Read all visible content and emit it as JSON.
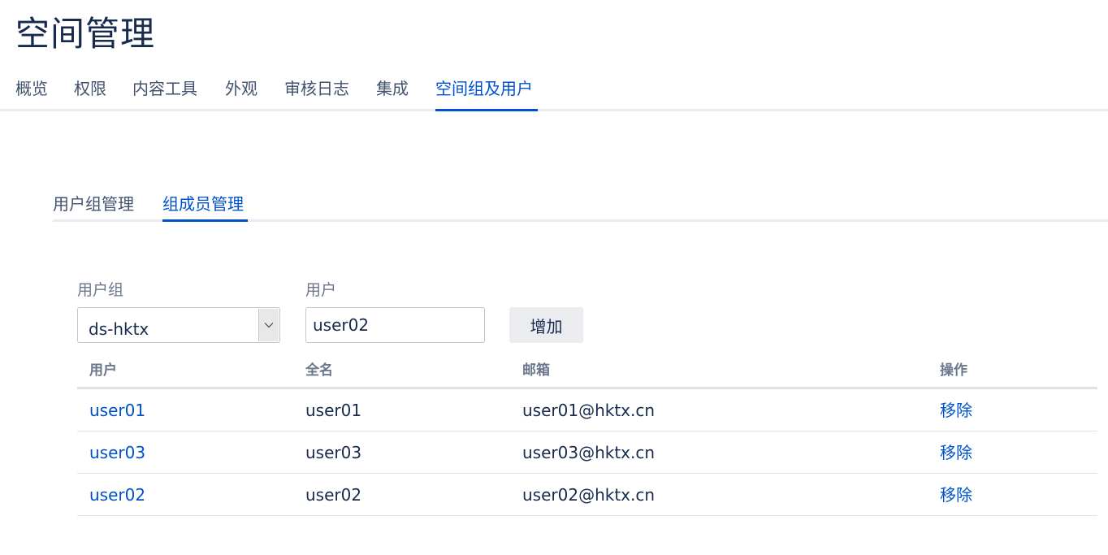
{
  "page": {
    "title": "空间管理"
  },
  "top_tabs": [
    {
      "label": "概览"
    },
    {
      "label": "权限"
    },
    {
      "label": "内容工具"
    },
    {
      "label": "外观"
    },
    {
      "label": "审核日志"
    },
    {
      "label": "集成"
    },
    {
      "label": "空间组及用户",
      "active": true
    }
  ],
  "sub_tabs": [
    {
      "label": "用户组管理"
    },
    {
      "label": "组成员管理",
      "active": true
    }
  ],
  "form": {
    "group_label": "用户组",
    "group_value": "ds-hktx",
    "user_label": "用户",
    "user_value": "user02",
    "add_button_label": "增加"
  },
  "table": {
    "columns": [
      "用户",
      "全名",
      "邮箱",
      "操作"
    ],
    "rows": [
      {
        "user": "user01",
        "full_name": "user01",
        "email": "user01@hktx.cn",
        "action": "移除"
      },
      {
        "user": "user03",
        "full_name": "user03",
        "email": "user03@hktx.cn",
        "action": "移除"
      },
      {
        "user": "user02",
        "full_name": "user02",
        "email": "user02@hktx.cn",
        "action": "移除"
      }
    ]
  },
  "colors": {
    "accent": "#0052cc",
    "text": "#172b4d",
    "muted": "#6b778c",
    "border": "#dfe1e6"
  },
  "icons": {
    "select_arrow": "chevron-down-icon"
  }
}
